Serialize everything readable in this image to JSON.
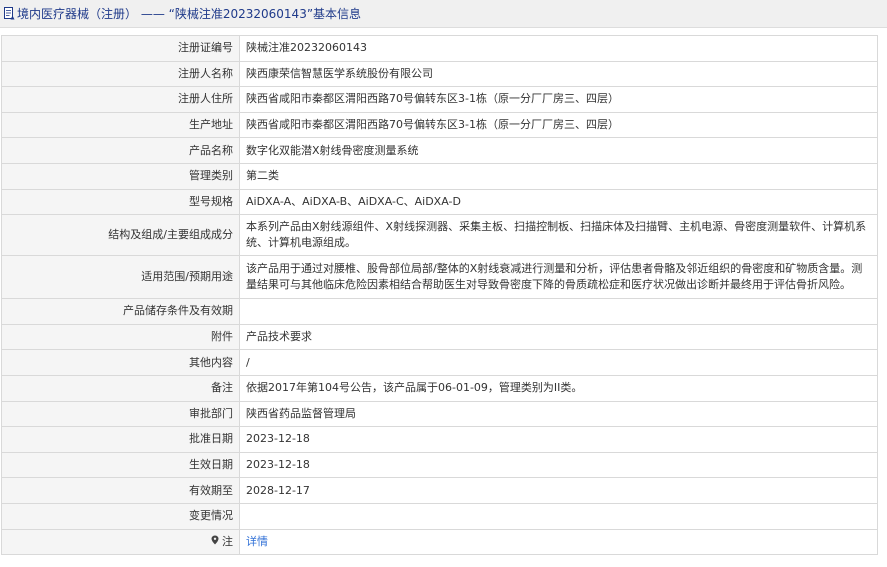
{
  "header": {
    "title": "境内医疗器械（注册） —— “陕械注准20232060143”基本信息"
  },
  "rows": [
    {
      "label": "注册证编号",
      "value": "陕械注准20232060143"
    },
    {
      "label": "注册人名称",
      "value": "陕西康荣信智慧医学系统股份有限公司"
    },
    {
      "label": "注册人住所",
      "value": "陕西省咸阳市秦都区渭阳西路70号偏转东区3-1栋（原一分厂厂房三、四层）"
    },
    {
      "label": "生产地址",
      "value": "陕西省咸阳市秦都区渭阳西路70号偏转东区3-1栋（原一分厂厂房三、四层）"
    },
    {
      "label": "产品名称",
      "value": "数字化双能潜X射线骨密度测量系统"
    },
    {
      "label": "管理类别",
      "value": "第二类"
    },
    {
      "label": "型号规格",
      "value": "AiDXA-A、AiDXA-B、AiDXA-C、AiDXA-D"
    },
    {
      "label": "结构及组成/主要组成成分",
      "value": "本系列产品由X射线源组件、X射线探测器、采集主板、扫描控制板、扫描床体及扫描臂、主机电源、骨密度测量软件、计算机系统、计算机电源组成。"
    },
    {
      "label": "适用范围/预期用途",
      "value": "该产品用于通过对腰椎、股骨部位局部/整体的X射线衰减进行测量和分析，评估患者骨骼及邻近组织的骨密度和矿物质含量。测量结果可与其他临床危险因素相结合帮助医生对导致骨密度下降的骨质疏松症和医疗状况做出诊断并最终用于评估骨折风险。"
    },
    {
      "label": "产品储存条件及有效期",
      "value": ""
    },
    {
      "label": "附件",
      "value": "产品技术要求"
    },
    {
      "label": "其他内容",
      "value": "/"
    },
    {
      "label": "备注",
      "value": "依据2017年第104号公告，该产品属于06-01-09，管理类别为II类。"
    },
    {
      "label": "审批部门",
      "value": "陕西省药品监督管理局"
    },
    {
      "label": "批准日期",
      "value": "2023-12-18"
    },
    {
      "label": "生效日期",
      "value": "2023-12-18"
    },
    {
      "label": "有效期至",
      "value": "2028-12-17"
    },
    {
      "label": "变更情况",
      "value": ""
    },
    {
      "label": "注",
      "value": "详情"
    }
  ]
}
